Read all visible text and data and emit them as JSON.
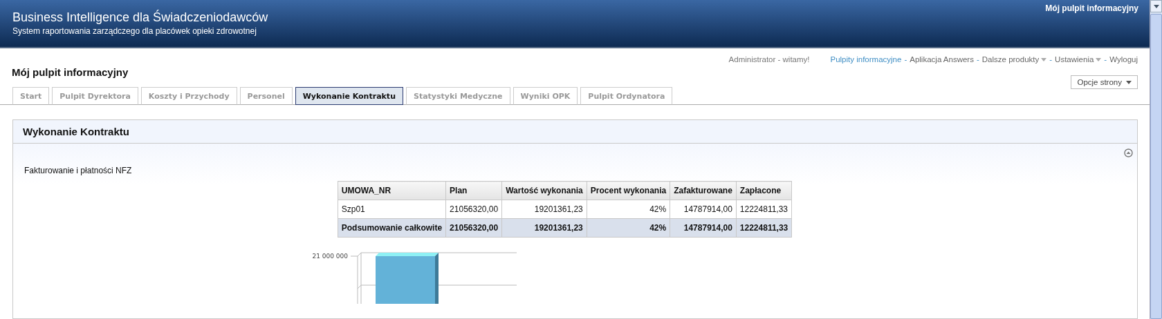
{
  "header": {
    "title": "Business Intelligence dla Świadczeniodawców",
    "subtitle": "System raportowania zarządczego dla placówek opieki zdrowotnej",
    "top_link": "Mój pulpit informacyjny"
  },
  "page_title": "Mój pulpit informacyjny",
  "greeting": "Administrator - witamy!",
  "nav": [
    {
      "label": "Pulpity informacyjne",
      "selected": true,
      "has_dropdown": false
    },
    {
      "label": "Aplikacja Answers",
      "selected": false,
      "has_dropdown": false
    },
    {
      "label": "Dalsze produkty",
      "selected": false,
      "has_dropdown": true
    },
    {
      "label": "Ustawienia",
      "selected": false,
      "has_dropdown": true
    },
    {
      "label": "Wyloguj",
      "selected": false,
      "has_dropdown": false
    }
  ],
  "nav_separator": "-",
  "page_options": "Opcje strony",
  "tabs": [
    {
      "label": "Start",
      "selected": false
    },
    {
      "label": "Pulpit Dyrektora",
      "selected": false
    },
    {
      "label": "Koszty i Przychody",
      "selected": false
    },
    {
      "label": "Personel",
      "selected": false
    },
    {
      "label": "Wykonanie Kontraktu",
      "selected": true
    },
    {
      "label": "Statystyki Medyczne",
      "selected": false
    },
    {
      "label": "Wyniki OPK",
      "selected": false
    },
    {
      "label": "Pulpit Ordynatora",
      "selected": false
    }
  ],
  "section": {
    "title": "Wykonanie Kontraktu",
    "expanded": true,
    "report_title": "Fakturowanie i płatności NFZ",
    "table": {
      "columns": [
        "UMOWA_NR",
        "Plan",
        "Wartość wykonania",
        "Procent wykonania",
        "Zafakturowane",
        "Zapłacone"
      ],
      "rows": [
        {
          "kind": "data",
          "cells": [
            "Szp01",
            "21056320,00",
            "19201361,23",
            "42%",
            "14787914,00",
            "12224811,33"
          ]
        },
        {
          "kind": "total",
          "cells": [
            "Podsumowanie całkowite",
            "21056320,00",
            "19201361,23",
            "42%",
            "14787914,00",
            "12224811,33"
          ]
        }
      ]
    },
    "chart": {
      "tick_label": "21 000 000"
    }
  }
}
